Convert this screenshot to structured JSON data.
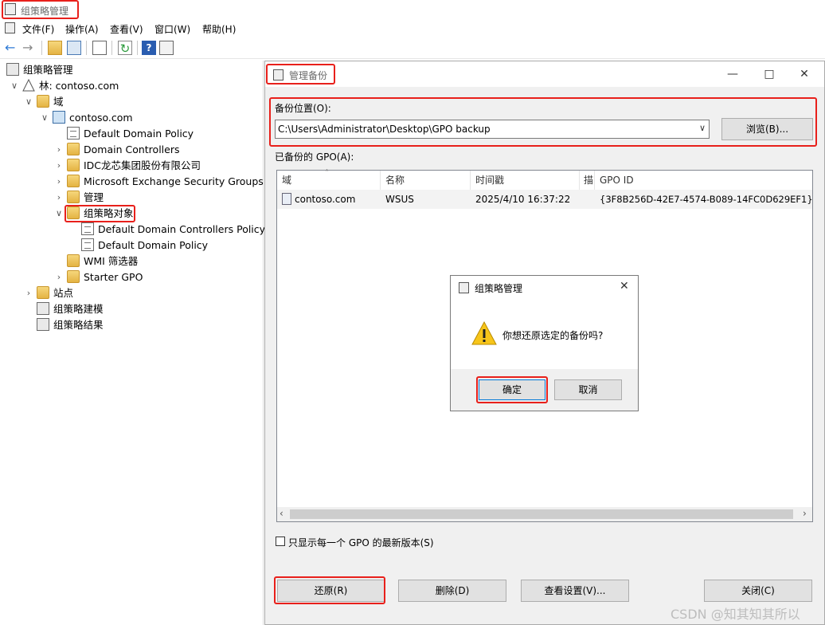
{
  "app": {
    "title": "组策略管理",
    "menu": [
      "文件(F)",
      "操作(A)",
      "查看(V)",
      "窗口(W)",
      "帮助(H)"
    ]
  },
  "tree": {
    "root": "组策略管理",
    "forest": "林: contoso.com",
    "domains": "域",
    "domain": "contoso.com",
    "items": {
      "ddp": "Default Domain Policy",
      "dc": "Domain Controllers",
      "idc": "IDC龙芯集团股份有限公司",
      "mesg": "Microsoft Exchange Security Groups",
      "mgmt": "管理",
      "gpo_objects": "组策略对象",
      "ddcp": "Default Domain Controllers Policy",
      "ddp2": "Default Domain Policy",
      "wmi": "WMI 筛选器",
      "starter": "Starter GPO"
    },
    "sites": "站点",
    "modeling": "组策略建模",
    "results": "组策略结果"
  },
  "dialog": {
    "title": "管理备份",
    "location_label": "备份位置(O):",
    "location_value": "C:\\Users\\Administrator\\Desktop\\GPO backup",
    "browse": "浏览(B)...",
    "backed_up_label": "已备份的 GPO(A):",
    "columns": [
      "域",
      "名称",
      "时间戳",
      "描",
      "GPO ID"
    ],
    "rows": [
      {
        "domain": "contoso.com",
        "name": "WSUS",
        "timestamp": "2025/4/10 16:37:22",
        "desc": "",
        "gpo_id": "{3F8B256D-42E7-4574-B089-14FC0D629EF1}"
      }
    ],
    "latest_only": "只显示每一个 GPO 的最新版本(S)",
    "restore": "还原(R)",
    "delete": "删除(D)",
    "view_settings": "查看设置(V)...",
    "close": "关闭(C)"
  },
  "confirm": {
    "title": "组策略管理",
    "message": "你想还原选定的备份吗?",
    "ok": "确定",
    "cancel": "取消"
  },
  "watermark": "CSDN @知其知其所以"
}
